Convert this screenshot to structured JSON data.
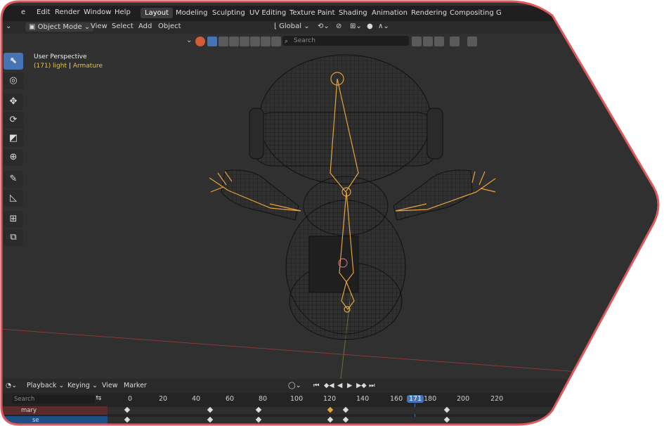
{
  "menubar": {
    "menus": [
      "e",
      "Edit",
      "Render",
      "Window",
      "Help"
    ],
    "workspaces": [
      "Layout",
      "Modeling",
      "Sculpting",
      "UV Editing",
      "Texture Paint",
      "Shading",
      "Animation",
      "Rendering",
      "Compositing",
      "G"
    ],
    "active_workspace": "Layout"
  },
  "header": {
    "mode": "Object Mode",
    "menus": [
      "View",
      "Select",
      "Add",
      "Object"
    ],
    "orientation": "Global"
  },
  "viewport": {
    "search_placeholder": "Search",
    "perspective": "User Perspective",
    "info_prefix": "(171) light",
    "info_sep": "|",
    "info_active": "Armature"
  },
  "toolbar": {
    "tools": [
      "select-box-icon",
      "cursor-icon",
      "move-icon",
      "rotate-icon",
      "scale-icon",
      "transform-icon",
      "annotate-icon",
      "measure-icon",
      "add-cube-icon",
      "extrude-icon"
    ]
  },
  "timeline": {
    "menus": [
      "Playback",
      "Keying",
      "View",
      "Marker"
    ],
    "search_placeholder": "Search",
    "frames": [
      "0",
      "20",
      "40",
      "60",
      "80",
      "100",
      "120",
      "140",
      "160",
      "171",
      "180",
      "200",
      "220"
    ],
    "current_frame": "171",
    "rows": [
      "mary",
      "se"
    ]
  },
  "colors": {
    "accent": "#4772b3",
    "armature": "#e8a33c",
    "frame_outline": "#e0585c"
  }
}
